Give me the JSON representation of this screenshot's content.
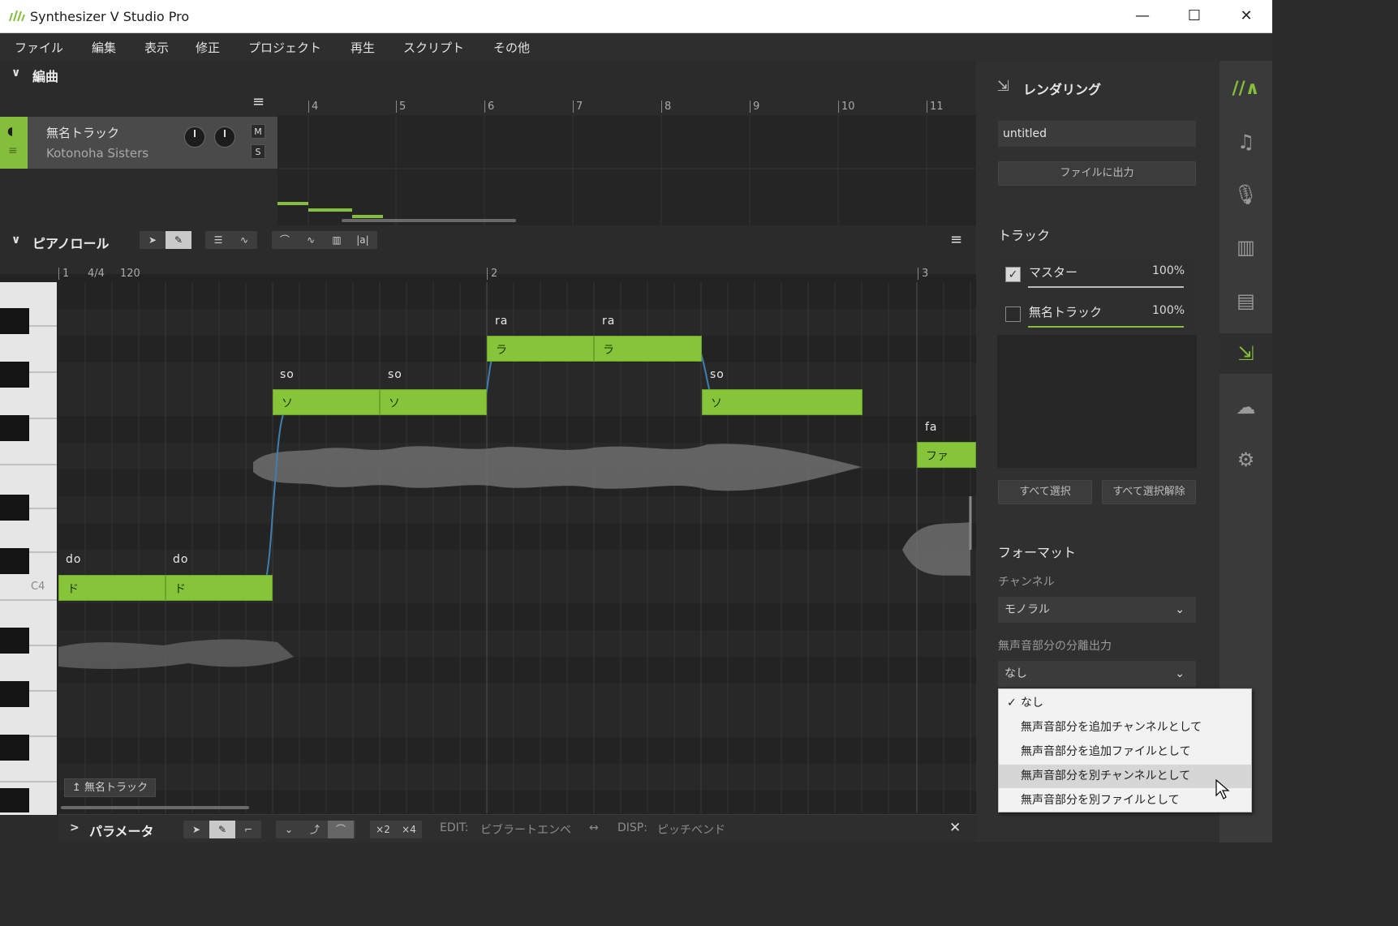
{
  "window": {
    "title": "Synthesizer V Studio Pro",
    "minimize": "—",
    "maximize": "☐",
    "close": "✕"
  },
  "menu": [
    "ファイル",
    "編集",
    "表示",
    "修正",
    "プロジェクト",
    "再生",
    "スクリプト",
    "その他"
  ],
  "arrangement": {
    "label": "編曲",
    "ruler": [
      "4",
      "5",
      "6",
      "7",
      "8",
      "9",
      "10",
      "11"
    ],
    "track": {
      "name": "無名トラック",
      "voice": "Kotonoha Sisters",
      "mute": "M",
      "solo": "S"
    }
  },
  "pianoroll": {
    "label": "ピアノロール",
    "ruler": {
      "bar1": "1",
      "timesig": "4/4",
      "tempo": "120",
      "bar2": "2",
      "bar3": "3"
    },
    "key_label": "C4",
    "notes": [
      {
        "lyric": "do",
        "phoneme": "ド"
      },
      {
        "lyric": "do",
        "phoneme": "ド"
      },
      {
        "lyric": "so",
        "phoneme": "ソ"
      },
      {
        "lyric": "so",
        "phoneme": "ソ"
      },
      {
        "lyric": "ra",
        "phoneme": "ラ"
      },
      {
        "lyric": "ra",
        "phoneme": "ラ"
      },
      {
        "lyric": "so",
        "phoneme": "ソ"
      },
      {
        "lyric": "fa",
        "phoneme": "ファ"
      }
    ],
    "track_tag": "↥ 無名トラック"
  },
  "params": {
    "label": "パラメータ",
    "x2": "×2",
    "x4": "×4",
    "edit_label": "EDIT:",
    "edit_value": "ビブラートエンベ",
    "swap": "↔",
    "disp_label": "DISP:",
    "disp_value": "ピッチベンド",
    "close": "✕"
  },
  "render_panel": {
    "title": "レンダリング",
    "filename": "untitled",
    "export_button": "ファイルに出力",
    "tracks_heading": "トラック",
    "tracks": [
      {
        "name": "マスター",
        "volume": "100%",
        "checked": true
      },
      {
        "name": "無名トラック",
        "volume": "100%",
        "checked": false
      }
    ],
    "select_all": "すべて選択",
    "deselect_all": "すべて選択解除",
    "format_heading": "フォーマット",
    "channel_label": "チャンネル",
    "channel_value": "モノラル",
    "unvoiced_label": "無声音部分の分離出力",
    "unvoiced_value": "なし",
    "unvoiced_options": [
      "なし",
      "無声音部分を追加チャンネルとして",
      "無声音部分を追加ファイルとして",
      "無声音部分を別チャンネルとして",
      "無声音部分を別ファイルとして"
    ],
    "selected_option_check": "✓"
  },
  "side_icons": [
    "logo-icon",
    "note-icon",
    "microphone-icon",
    "library-icon",
    "book-icon",
    "render-icon",
    "cloud-icon",
    "gear-icon"
  ],
  "colors": {
    "accent": "#85bd3c",
    "note": "#86c43a"
  }
}
